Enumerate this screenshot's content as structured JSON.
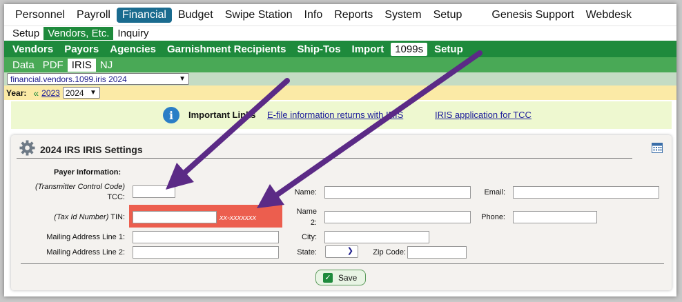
{
  "main_nav": [
    "Personnel",
    "Payroll",
    "Financial",
    "Budget",
    "Swipe Station",
    "Info",
    "Reports",
    "System",
    "Setup"
  ],
  "main_nav_right": [
    "Genesis Support",
    "Webdesk"
  ],
  "sub_nav": [
    "Setup",
    "Vendors, Etc.",
    "Inquiry"
  ],
  "vendors_nav": [
    "Vendors",
    "Payors",
    "Agencies",
    "Garnishment Recipients",
    "Ship-Tos",
    "Import",
    "1099s",
    "Setup"
  ],
  "tabs_1099": [
    "Data",
    "PDF",
    "IRIS",
    "NJ"
  ],
  "screen_select": "financial.vendors.1099.iris 2024",
  "year": {
    "label": "Year:",
    "prev_year": "2023",
    "selected": "2024"
  },
  "info": {
    "title": "Important Links",
    "link1": "E-file information returns with IRIS",
    "link2": "IRIS application for TCC"
  },
  "panel": {
    "title": "2024 IRS IRIS Settings",
    "payer_info": "Payer Information:",
    "tcc_hint": "(Transmitter Control Code)",
    "tcc_label": "TCC:",
    "tin_hint": "(Tax Id Number)",
    "tin_label": "TIN:",
    "tin_format": "xx-xxxxxxx",
    "mail1_label": "Mailing Address Line 1:",
    "mail2_label": "Mailing Address Line 2:",
    "name_label": "Name:",
    "name2_label_a": "Name",
    "name2_label_b": "2:",
    "city_label": "City:",
    "state_label": "State:",
    "email_label": "Email:",
    "phone_label": "Phone:",
    "zip_label": "Zip Code:",
    "save_label": "Save"
  },
  "colors": {
    "nav_dark_green": "#1e8a3c",
    "nav_light_green": "#49a956",
    "active_blue": "#1a6b8f",
    "highlight_red": "#ec5e4e",
    "arrow_purple": "#5b2a86"
  }
}
